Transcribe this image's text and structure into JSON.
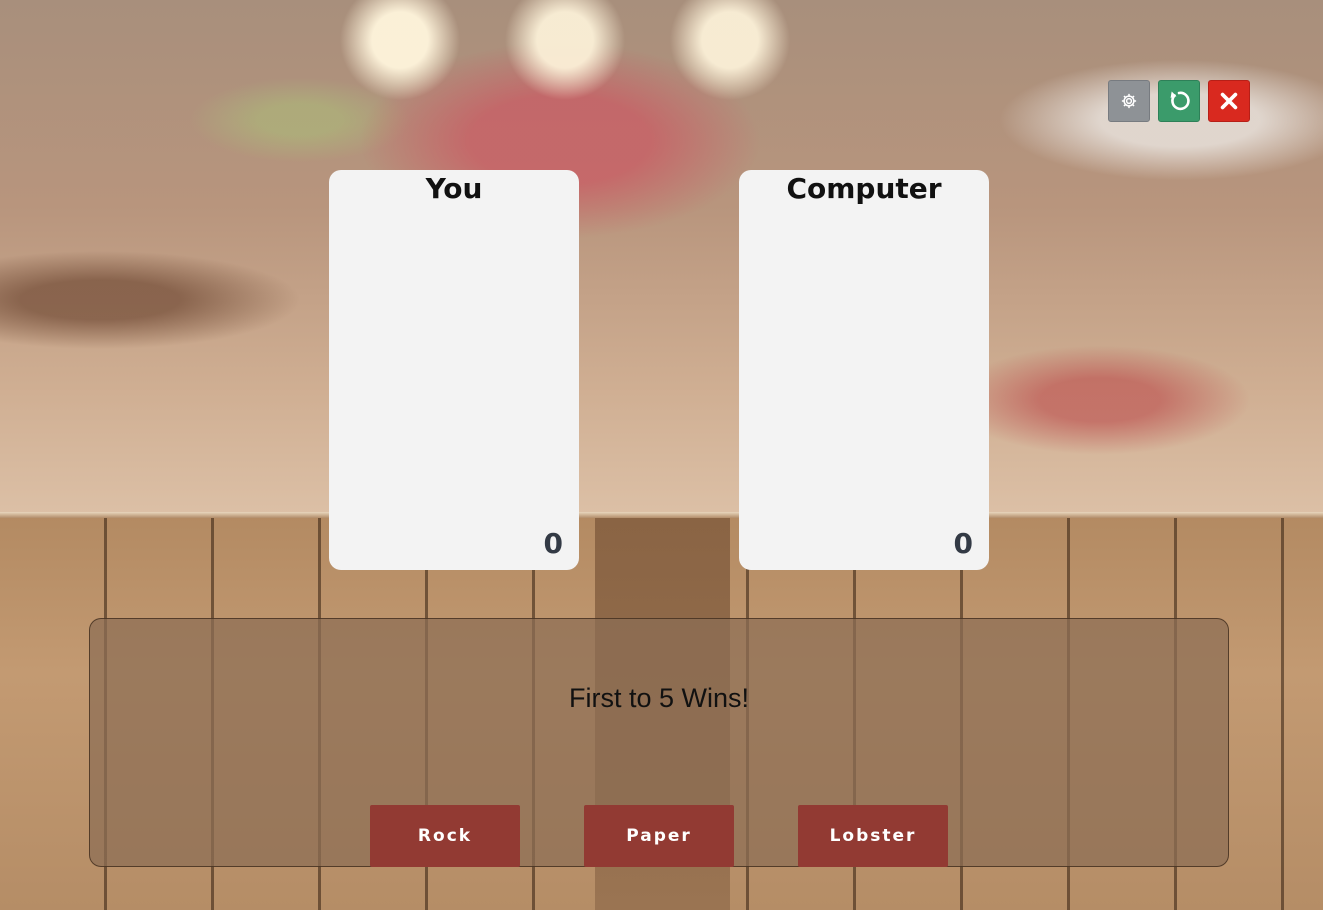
{
  "controls": {
    "settings_icon": "gear-icon",
    "restart_icon": "restart-icon",
    "close_icon": "close-icon",
    "colors": {
      "settings": "#8e9296",
      "restart": "#3b9b6b",
      "close": "#d9291f"
    }
  },
  "player": {
    "title": "You",
    "score": "0"
  },
  "computer": {
    "title": "Computer",
    "score": "0"
  },
  "panel": {
    "message": "First to 5 Wins!"
  },
  "choices": [
    {
      "label": "Rock"
    },
    {
      "label": "Paper"
    },
    {
      "label": "Lobster"
    }
  ],
  "colors": {
    "choice_button": "#923a33",
    "card": "#f3f3f3"
  }
}
